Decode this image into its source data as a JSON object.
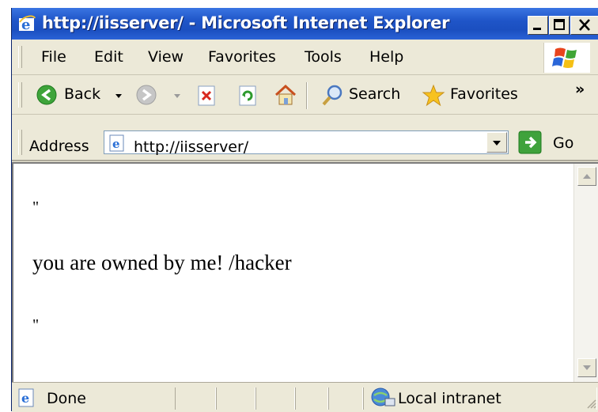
{
  "window": {
    "title": "http://iisserver/ - Microsoft Internet Explorer"
  },
  "menu": [
    "File",
    "Edit",
    "View",
    "Favorites",
    "Tools",
    "Help"
  ],
  "toolbar": {
    "back_label": "Back",
    "search_label": "Search",
    "favorites_label": "Favorites",
    "overflow": "»"
  },
  "address": {
    "label": "Address",
    "url": "http://iisserver/",
    "go_label": "Go"
  },
  "page": {
    "line1": "\"",
    "message": "you are owned by me! /hacker",
    "line3": "\""
  },
  "status": {
    "text": "Done",
    "zone": "Local intranet"
  },
  "colors": {
    "titlebar": "#1f55c8",
    "chrome": "#ece9d8"
  }
}
